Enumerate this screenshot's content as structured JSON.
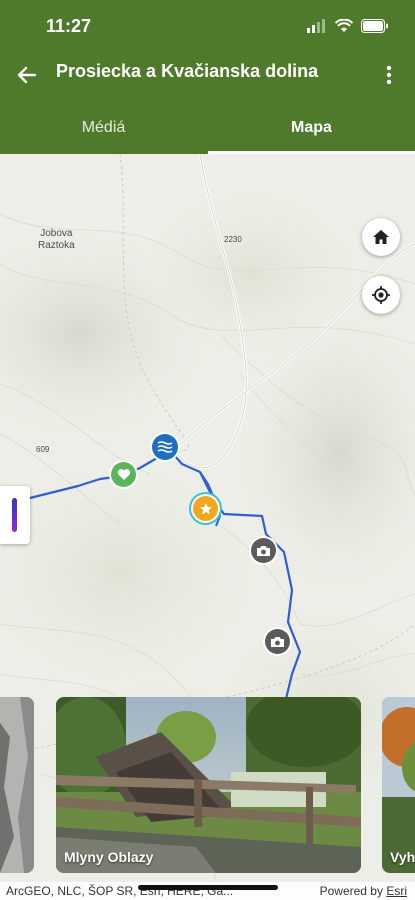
{
  "status_bar": {
    "time": "11:27"
  },
  "app_bar": {
    "title": "Prosiecka a Kvačianska dolina"
  },
  "tabs": [
    {
      "label": "Médiá",
      "selected": false
    },
    {
      "label": "Mapa",
      "selected": true
    }
  ],
  "map": {
    "labels": {
      "place": "Jobova\nRaztoka",
      "road_small": "2230",
      "elevation": "609"
    },
    "controls": {
      "home_icon": "home-icon",
      "locate_icon": "crosshair-locate-icon"
    },
    "markers": [
      {
        "name": "water-marker",
        "icon": "water-waves-icon",
        "color": "#1f6fbf"
      },
      {
        "name": "viewpoint-marker",
        "icon": "heart-icon",
        "color": "#5bb55a"
      },
      {
        "name": "poi-marker-selected",
        "icon": "star-badge-icon",
        "color": "#f2a81d"
      },
      {
        "name": "photo-marker-1",
        "icon": "camera-icon",
        "color": "#5b5b5b"
      },
      {
        "name": "photo-marker-2",
        "icon": "camera-icon",
        "color": "#5b5b5b"
      }
    ],
    "route_color": "#2f5fd0"
  },
  "carousel": {
    "cards": [
      {
        "label": ""
      },
      {
        "label": "Mlyny Oblazy"
      },
      {
        "label": "Vyh"
      }
    ]
  },
  "attribution": {
    "left": "ArcGEO, NLC, ŠOP SR, Esri, HERE, Ga...",
    "powered": "Powered by",
    "brand": "Esri"
  },
  "colors": {
    "primary": "#4f7a2c"
  }
}
